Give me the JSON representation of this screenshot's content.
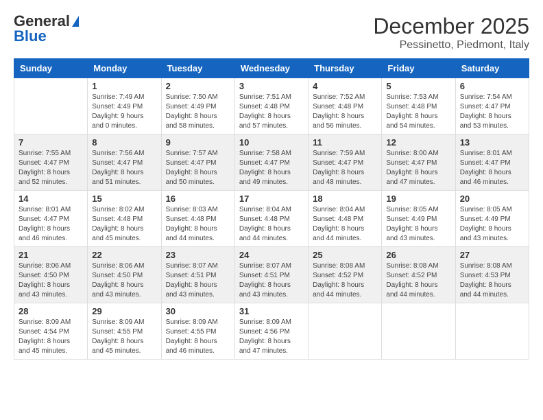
{
  "header": {
    "logo_general": "General",
    "logo_blue": "Blue",
    "month": "December 2025",
    "location": "Pessinetto, Piedmont, Italy"
  },
  "days_of_week": [
    "Sunday",
    "Monday",
    "Tuesday",
    "Wednesday",
    "Thursday",
    "Friday",
    "Saturday"
  ],
  "weeks": [
    [
      {
        "day": "",
        "info": ""
      },
      {
        "day": "1",
        "info": "Sunrise: 7:49 AM\nSunset: 4:49 PM\nDaylight: 9 hours\nand 0 minutes."
      },
      {
        "day": "2",
        "info": "Sunrise: 7:50 AM\nSunset: 4:49 PM\nDaylight: 8 hours\nand 58 minutes."
      },
      {
        "day": "3",
        "info": "Sunrise: 7:51 AM\nSunset: 4:48 PM\nDaylight: 8 hours\nand 57 minutes."
      },
      {
        "day": "4",
        "info": "Sunrise: 7:52 AM\nSunset: 4:48 PM\nDaylight: 8 hours\nand 56 minutes."
      },
      {
        "day": "5",
        "info": "Sunrise: 7:53 AM\nSunset: 4:48 PM\nDaylight: 8 hours\nand 54 minutes."
      },
      {
        "day": "6",
        "info": "Sunrise: 7:54 AM\nSunset: 4:47 PM\nDaylight: 8 hours\nand 53 minutes."
      }
    ],
    [
      {
        "day": "7",
        "info": "Sunrise: 7:55 AM\nSunset: 4:47 PM\nDaylight: 8 hours\nand 52 minutes."
      },
      {
        "day": "8",
        "info": "Sunrise: 7:56 AM\nSunset: 4:47 PM\nDaylight: 8 hours\nand 51 minutes."
      },
      {
        "day": "9",
        "info": "Sunrise: 7:57 AM\nSunset: 4:47 PM\nDaylight: 8 hours\nand 50 minutes."
      },
      {
        "day": "10",
        "info": "Sunrise: 7:58 AM\nSunset: 4:47 PM\nDaylight: 8 hours\nand 49 minutes."
      },
      {
        "day": "11",
        "info": "Sunrise: 7:59 AM\nSunset: 4:47 PM\nDaylight: 8 hours\nand 48 minutes."
      },
      {
        "day": "12",
        "info": "Sunrise: 8:00 AM\nSunset: 4:47 PM\nDaylight: 8 hours\nand 47 minutes."
      },
      {
        "day": "13",
        "info": "Sunrise: 8:01 AM\nSunset: 4:47 PM\nDaylight: 8 hours\nand 46 minutes."
      }
    ],
    [
      {
        "day": "14",
        "info": "Sunrise: 8:01 AM\nSunset: 4:47 PM\nDaylight: 8 hours\nand 46 minutes."
      },
      {
        "day": "15",
        "info": "Sunrise: 8:02 AM\nSunset: 4:48 PM\nDaylight: 8 hours\nand 45 minutes."
      },
      {
        "day": "16",
        "info": "Sunrise: 8:03 AM\nSunset: 4:48 PM\nDaylight: 8 hours\nand 44 minutes."
      },
      {
        "day": "17",
        "info": "Sunrise: 8:04 AM\nSunset: 4:48 PM\nDaylight: 8 hours\nand 44 minutes."
      },
      {
        "day": "18",
        "info": "Sunrise: 8:04 AM\nSunset: 4:48 PM\nDaylight: 8 hours\nand 44 minutes."
      },
      {
        "day": "19",
        "info": "Sunrise: 8:05 AM\nSunset: 4:49 PM\nDaylight: 8 hours\nand 43 minutes."
      },
      {
        "day": "20",
        "info": "Sunrise: 8:05 AM\nSunset: 4:49 PM\nDaylight: 8 hours\nand 43 minutes."
      }
    ],
    [
      {
        "day": "21",
        "info": "Sunrise: 8:06 AM\nSunset: 4:50 PM\nDaylight: 8 hours\nand 43 minutes."
      },
      {
        "day": "22",
        "info": "Sunrise: 8:06 AM\nSunset: 4:50 PM\nDaylight: 8 hours\nand 43 minutes."
      },
      {
        "day": "23",
        "info": "Sunrise: 8:07 AM\nSunset: 4:51 PM\nDaylight: 8 hours\nand 43 minutes."
      },
      {
        "day": "24",
        "info": "Sunrise: 8:07 AM\nSunset: 4:51 PM\nDaylight: 8 hours\nand 43 minutes."
      },
      {
        "day": "25",
        "info": "Sunrise: 8:08 AM\nSunset: 4:52 PM\nDaylight: 8 hours\nand 44 minutes."
      },
      {
        "day": "26",
        "info": "Sunrise: 8:08 AM\nSunset: 4:52 PM\nDaylight: 8 hours\nand 44 minutes."
      },
      {
        "day": "27",
        "info": "Sunrise: 8:08 AM\nSunset: 4:53 PM\nDaylight: 8 hours\nand 44 minutes."
      }
    ],
    [
      {
        "day": "28",
        "info": "Sunrise: 8:09 AM\nSunset: 4:54 PM\nDaylight: 8 hours\nand 45 minutes."
      },
      {
        "day": "29",
        "info": "Sunrise: 8:09 AM\nSunset: 4:55 PM\nDaylight: 8 hours\nand 45 minutes."
      },
      {
        "day": "30",
        "info": "Sunrise: 8:09 AM\nSunset: 4:55 PM\nDaylight: 8 hours\nand 46 minutes."
      },
      {
        "day": "31",
        "info": "Sunrise: 8:09 AM\nSunset: 4:56 PM\nDaylight: 8 hours\nand 47 minutes."
      },
      {
        "day": "",
        "info": ""
      },
      {
        "day": "",
        "info": ""
      },
      {
        "day": "",
        "info": ""
      }
    ]
  ]
}
